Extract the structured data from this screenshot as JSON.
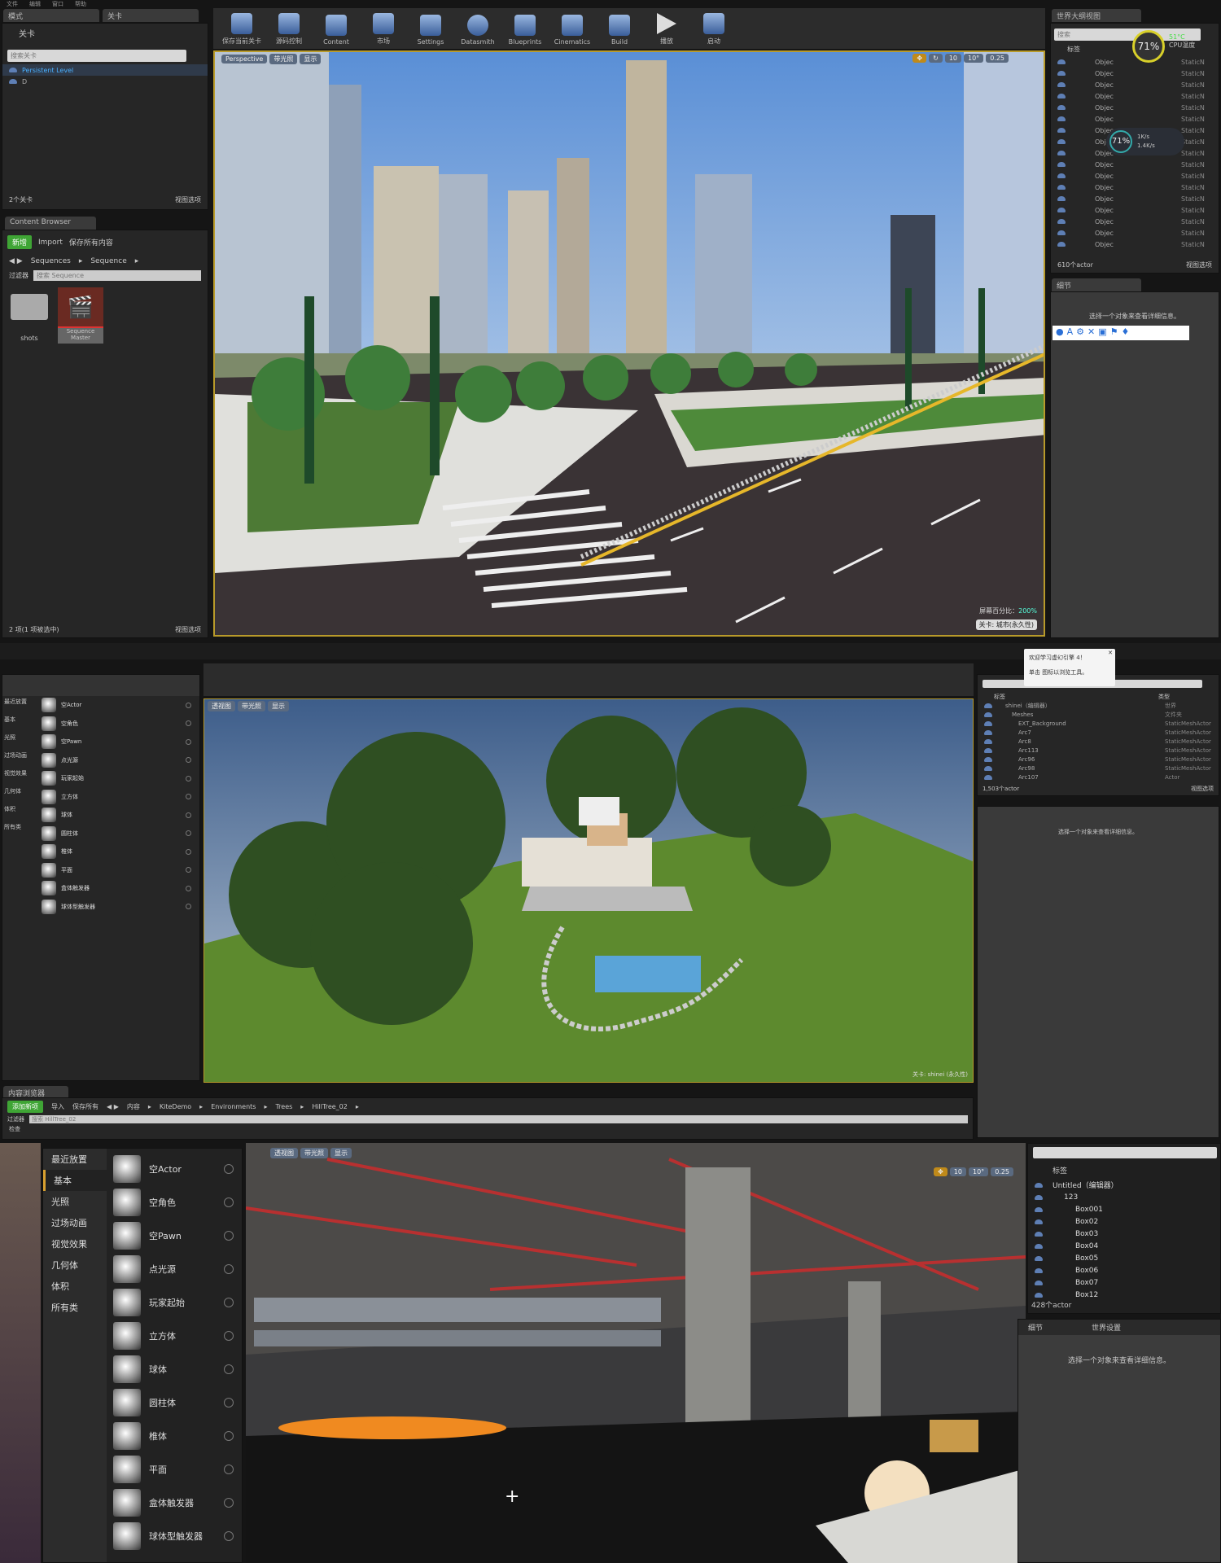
{
  "s1": {
    "menu": [
      "文件",
      "编辑",
      "窗口",
      "帮助"
    ],
    "tabs": [
      "模式",
      "关卡"
    ],
    "levels_header": "关卡",
    "level_search_placeholder": "搜索关卡",
    "levels": [
      "Persistent Level",
      "D"
    ],
    "level_count": "2个关卡",
    "view_options": "视图选项",
    "toolbar": [
      "保存当前关卡",
      "源码控制",
      "Content",
      "市场",
      "Settings",
      "Datasmith",
      "Blueprints",
      "Cinematics",
      "Build",
      "播放",
      "启动"
    ],
    "cb_tab": "Content Browser",
    "cb_new": "新增",
    "cb_import": "Import",
    "cb_save_all": "保存所有内容",
    "cb_path": [
      "Sequences",
      "Sequence"
    ],
    "cb_filter": "过滤器",
    "cb_search_placeholder": "搜索 Sequence",
    "cb_items": [
      "shots",
      "Sequence Master"
    ],
    "cb_count": "2 项(1 项被选中)",
    "viewport_btns": [
      "Perspective",
      "带光照",
      "显示"
    ],
    "viewport_right": [
      "10",
      "10°",
      "0.25"
    ],
    "screen_pct_label": "屏幕百分比：",
    "screen_pct": "200%",
    "level_badge": "关卡: 城市(永久性)",
    "outliner_tab": "世界大纲视图",
    "outliner_search": "搜索",
    "outliner_col_label": "标签",
    "outliner_rows": [
      "Objec",
      "Objec",
      "Objec",
      "Objec",
      "Objec",
      "Objec",
      "Objec",
      "Objec",
      "Objec",
      "Objec",
      "Objec",
      "Objec",
      "Objec",
      "Objec",
      "Objec",
      "Objec",
      "Objec"
    ],
    "outliner_type": "StaticN",
    "cpu_pct": "71%",
    "cpu_temp": "51°C",
    "cpu_label": "CPU温度",
    "mem_pct": "71%",
    "net_up": "1K/s",
    "net_down": "1.4K/s",
    "actor_count": "610个actor",
    "details_tab": "细节",
    "details_hint": "选择一个对象来查看详细信息。"
  },
  "s2": {
    "outliner_rows": [
      [
        "shinei（编辑器）",
        "世界"
      ],
      [
        "Meshes",
        "文件夹"
      ],
      [
        "EXT_Background",
        "StaticMeshActor"
      ],
      [
        "Arc7",
        "StaticMeshActor"
      ],
      [
        "Arc8",
        "StaticMeshActor"
      ],
      [
        "Arc113",
        "StaticMeshActor"
      ],
      [
        "Arc96",
        "StaticMeshActor"
      ],
      [
        "Arc98",
        "StaticMeshActor"
      ],
      [
        "Arc107",
        "Actor"
      ]
    ],
    "col_label": "标签",
    "col_type": "类型",
    "tooltip_line1": "欢迎学习虚幻引擎 4！",
    "tooltip_line2": "单击 图标以浏览工具。",
    "actor_count": "1,503个actor",
    "view_options": "视图选项",
    "details_hint": "选择一个对象来查看详细信息。",
    "place_items": [
      "空Actor",
      "空角色",
      "空Pawn",
      "点光源",
      "玩家起始",
      "立方体",
      "球体",
      "圆柱体",
      "椎体",
      "平面",
      "盒体触发器",
      "球体型触发器"
    ],
    "cats": [
      "最近放置",
      "基本",
      "光照",
      "过场动画",
      "视觉效果",
      "几何体",
      "体积",
      "所有类"
    ],
    "viewport_btns": [
      "透视图",
      "带光照",
      "显示"
    ],
    "level_badge": "关卡: shinei (永久性)",
    "cb_new": "添加新项",
    "cb_import": "导入",
    "cb_save": "保存所有",
    "cb_path": [
      "内容",
      "KiteDemo",
      "Environments",
      "Trees",
      "HillTree_02"
    ],
    "cb_filter": "过滤器",
    "cb_search": "搜索 HillTree_02",
    "cb_tab": "内容浏览器",
    "cb_status": "检查"
  },
  "s3": {
    "cats": [
      "最近放置",
      "基本",
      "光照",
      "过场动画",
      "视觉效果",
      "几何体",
      "体积",
      "所有类"
    ],
    "place_items": [
      "空Actor",
      "空角色",
      "空Pawn",
      "点光源",
      "玩家起始",
      "立方体",
      "球体",
      "圆柱体",
      "椎体",
      "平面",
      "盒体触发器",
      "球体型触发器"
    ],
    "viewport_btns": [
      "透视图",
      "带光照",
      "显示"
    ],
    "viewport_right": [
      "10",
      "10°",
      "0.25"
    ],
    "col_label": "标签",
    "tree": [
      "Untitled（编辑器）",
      "123",
      "Box001",
      "Box02",
      "Box03",
      "Box04",
      "Box05",
      "Box06",
      "Box07",
      "Box12"
    ],
    "actor_count": "428个actor",
    "details_tab": "细节",
    "world_tab": "世界设置",
    "details_hint": "选择一个对象来查看详细信息。"
  }
}
